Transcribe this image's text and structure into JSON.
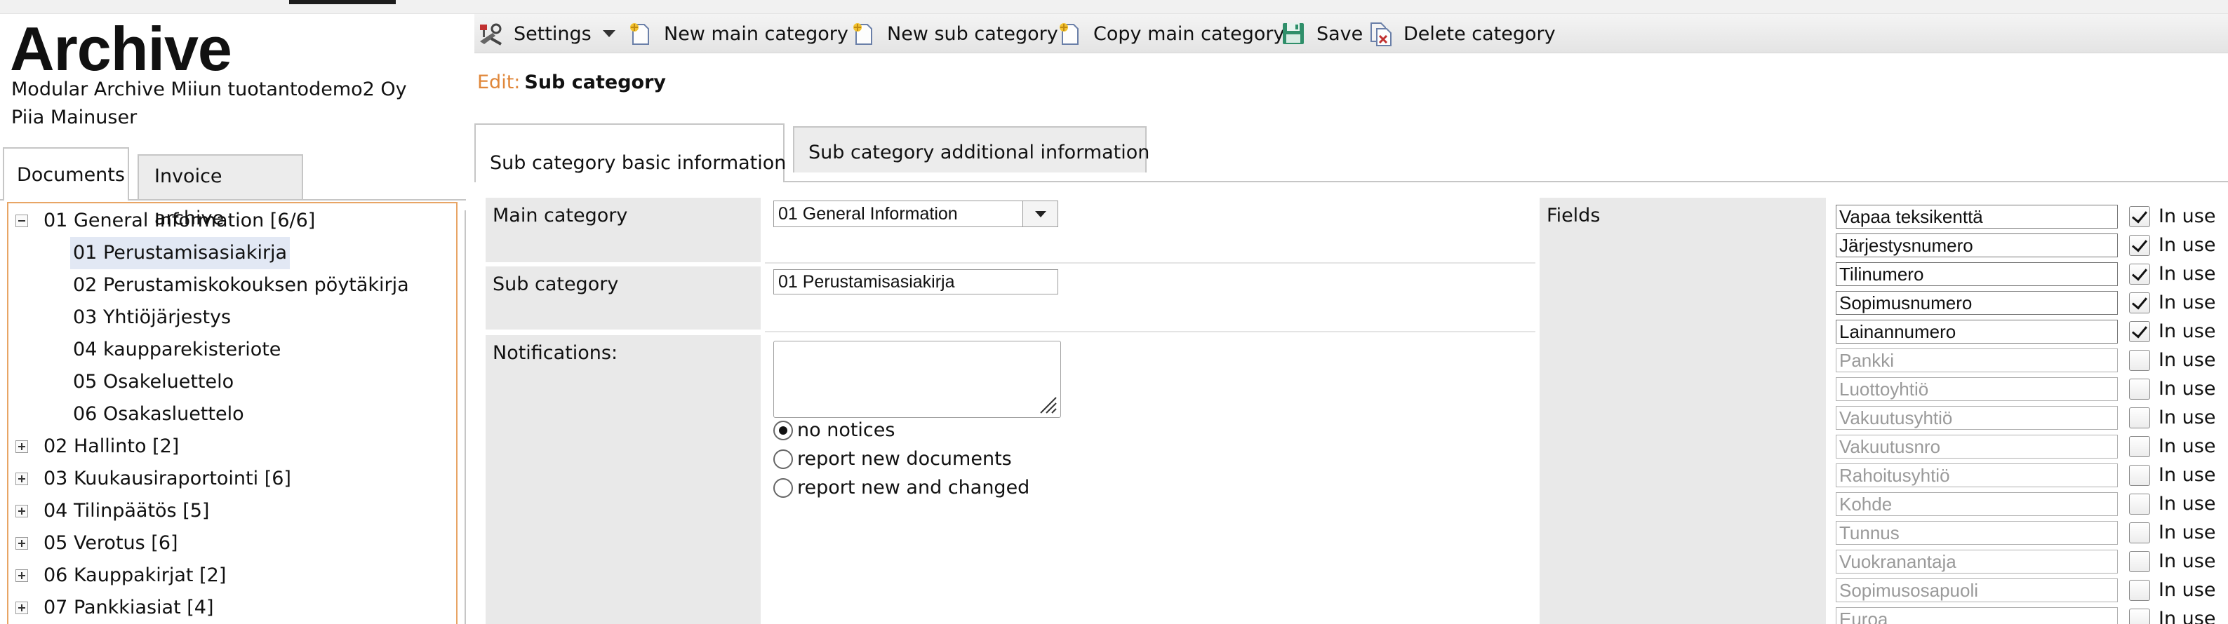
{
  "app": {
    "title": "Archive",
    "company": "Modular Archive Miiun tuotantodemo2 Oy",
    "user": "Piia Mainuser"
  },
  "left_tabs": [
    {
      "label": "Documents",
      "active": true
    },
    {
      "label": "Invoice archive",
      "active": false
    }
  ],
  "tree": [
    {
      "label": "01 General Information [6/6]",
      "level": 0,
      "expanded": true
    },
    {
      "label": "01 Perustamisasiakirja",
      "level": 1,
      "selected": true
    },
    {
      "label": "02 Perustamiskokouksen pöytäkirja",
      "level": 1
    },
    {
      "label": "03 Yhtiöjärjestys",
      "level": 1
    },
    {
      "label": "04 kaupparekisteriote",
      "level": 1
    },
    {
      "label": "05 Osakeluettelo",
      "level": 1
    },
    {
      "label": "06 Osakasluettelo",
      "level": 1
    },
    {
      "label": "02 Hallinto [2]",
      "level": 0,
      "expanded": false
    },
    {
      "label": "03 Kuukausiraportointi [6]",
      "level": 0,
      "expanded": false
    },
    {
      "label": "04 Tilinpäätös [5]",
      "level": 0,
      "expanded": false
    },
    {
      "label": "05 Verotus [6]",
      "level": 0,
      "expanded": false
    },
    {
      "label": "06 Kauppakirjat [2]",
      "level": 0,
      "expanded": false
    },
    {
      "label": "07 Pankkiasiat [4]",
      "level": 0,
      "expanded": false
    }
  ],
  "toolbar": {
    "settings": "Settings",
    "new_main": "New main category",
    "new_sub": "New sub category",
    "copy_main": "Copy main category",
    "save": "Save",
    "delete": "Delete category"
  },
  "edit": {
    "label": "Edit:",
    "value": "Sub category"
  },
  "main_tabs": [
    {
      "label": "Sub category basic information",
      "active": true
    },
    {
      "label": "Sub category additional information",
      "active": false
    }
  ],
  "form": {
    "main_category_label": "Main category",
    "main_category_value": "01 General Information",
    "sub_category_label": "Sub category",
    "sub_category_value": "01 Perustamisasiakirja",
    "notifications_label": "Notifications:",
    "notifications_value": "",
    "radios": [
      {
        "label": "no notices",
        "checked": true
      },
      {
        "label": "report new documents",
        "checked": false
      },
      {
        "label": "report new and changed",
        "checked": false
      }
    ],
    "fields_label": "Fields",
    "in_use_label": "In use",
    "fields": [
      {
        "name": "Vapaa teksikenttä",
        "in_use": true
      },
      {
        "name": "Järjestysnumero",
        "in_use": true
      },
      {
        "name": "Tilinumero",
        "in_use": true
      },
      {
        "name": "Sopimusnumero",
        "in_use": true
      },
      {
        "name": "Lainannumero",
        "in_use": true
      },
      {
        "name": "Pankki",
        "in_use": false
      },
      {
        "name": "Luottoyhtiö",
        "in_use": false
      },
      {
        "name": "Vakuutusyhtiö",
        "in_use": false
      },
      {
        "name": "Vakuutusnro",
        "in_use": false
      },
      {
        "name": "Rahoitusyhtiö",
        "in_use": false
      },
      {
        "name": "Kohde",
        "in_use": false
      },
      {
        "name": "Tunnus",
        "in_use": false
      },
      {
        "name": "Vuokranantaja",
        "in_use": false
      },
      {
        "name": "Sopimusosapuoli",
        "in_use": false
      },
      {
        "name": "Euroa",
        "in_use": false
      }
    ]
  },
  "colors": {
    "accent_orange": "#e0873a",
    "tree_border": "#e8a565",
    "label_cell_bg": "#e9e9e9",
    "selected_bg": "#e2e8f4"
  }
}
